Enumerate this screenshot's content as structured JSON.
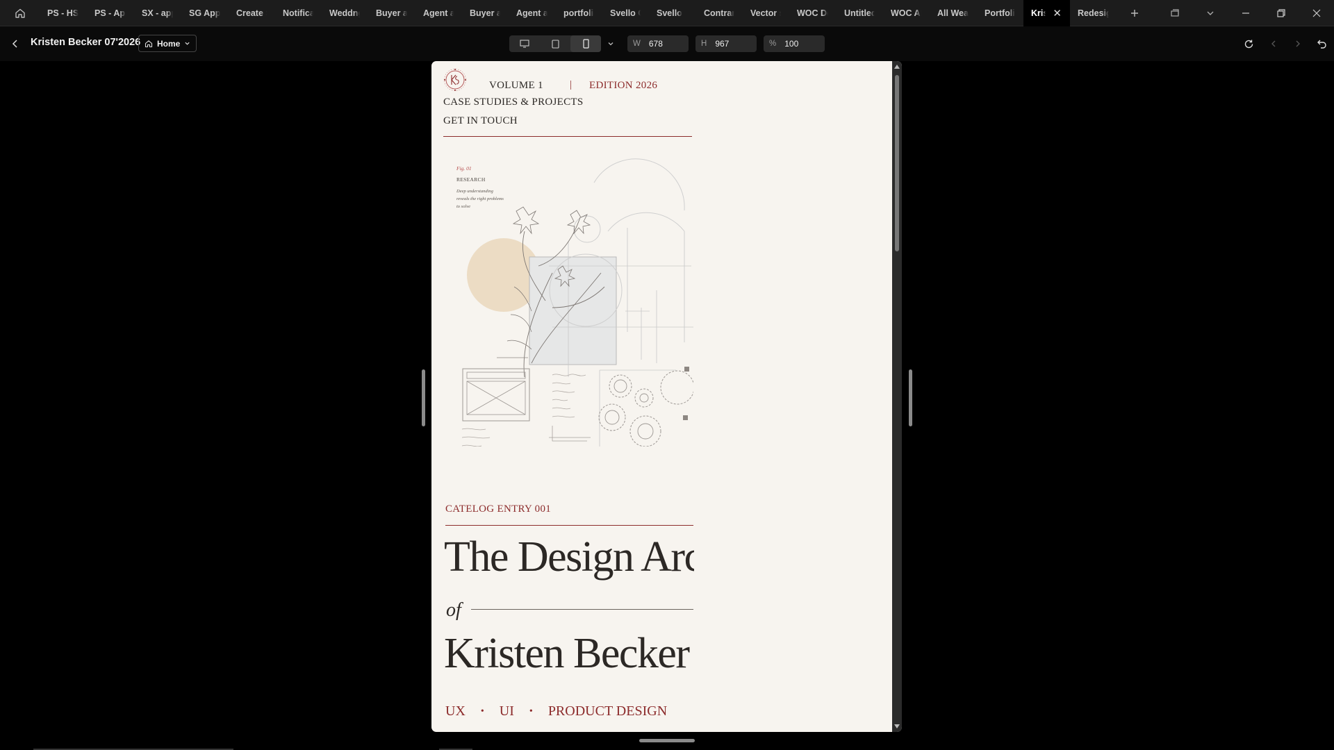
{
  "tabs": [
    {
      "label": "PS - HS, I"
    },
    {
      "label": "PS - App"
    },
    {
      "label": "SX - app"
    },
    {
      "label": "SG App"
    },
    {
      "label": "Create S"
    },
    {
      "label": "Notificat"
    },
    {
      "label": "Weddng"
    },
    {
      "label": "Buyer ap"
    },
    {
      "label": "Agent ap"
    },
    {
      "label": "Buyer ap"
    },
    {
      "label": "Agent ap"
    },
    {
      "label": "portfolio"
    },
    {
      "label": "Svello Cu"
    },
    {
      "label": "Svello"
    },
    {
      "label": "Contrari"
    },
    {
      "label": "Vector sp"
    },
    {
      "label": "WOC De"
    },
    {
      "label": "Untitled"
    },
    {
      "label": "WOC All"
    },
    {
      "label": "All Weat"
    },
    {
      "label": "Portfolio"
    },
    {
      "label": "Krist",
      "active": true
    },
    {
      "label": "Redesign"
    }
  ],
  "toolbar": {
    "project_title": "Kristen Becker 07'2026",
    "page_selector": "Home",
    "width_key": "W",
    "width_value": "678",
    "height_key": "H",
    "height_value": "967",
    "zoom_key": "%",
    "zoom_value": "100"
  },
  "page": {
    "volume": "VOLUME 1",
    "separator": "|",
    "edition": "EDITION 2026",
    "nav_case_studies": "CASE STUDIES & PROJECTS",
    "nav_contact": "GET IN TOUCH",
    "fig_label": "Fig. 01",
    "fig_title": "RESEARCH",
    "fig_desc": "Deep understanding reveals the right problems to solve",
    "catalog_entry": "CATELOG ENTRY 001",
    "title_line1": "The Design Arc",
    "title_of": "of",
    "title_line2": "Kristen Becker",
    "tags": [
      "UX",
      "UI",
      "PRODUCT DESIGN"
    ]
  },
  "colors": {
    "accent_red": "#8c2b2b",
    "page_bg": "#f7f4ef",
    "ink": "#2c2825",
    "app_bg": "#000000"
  }
}
